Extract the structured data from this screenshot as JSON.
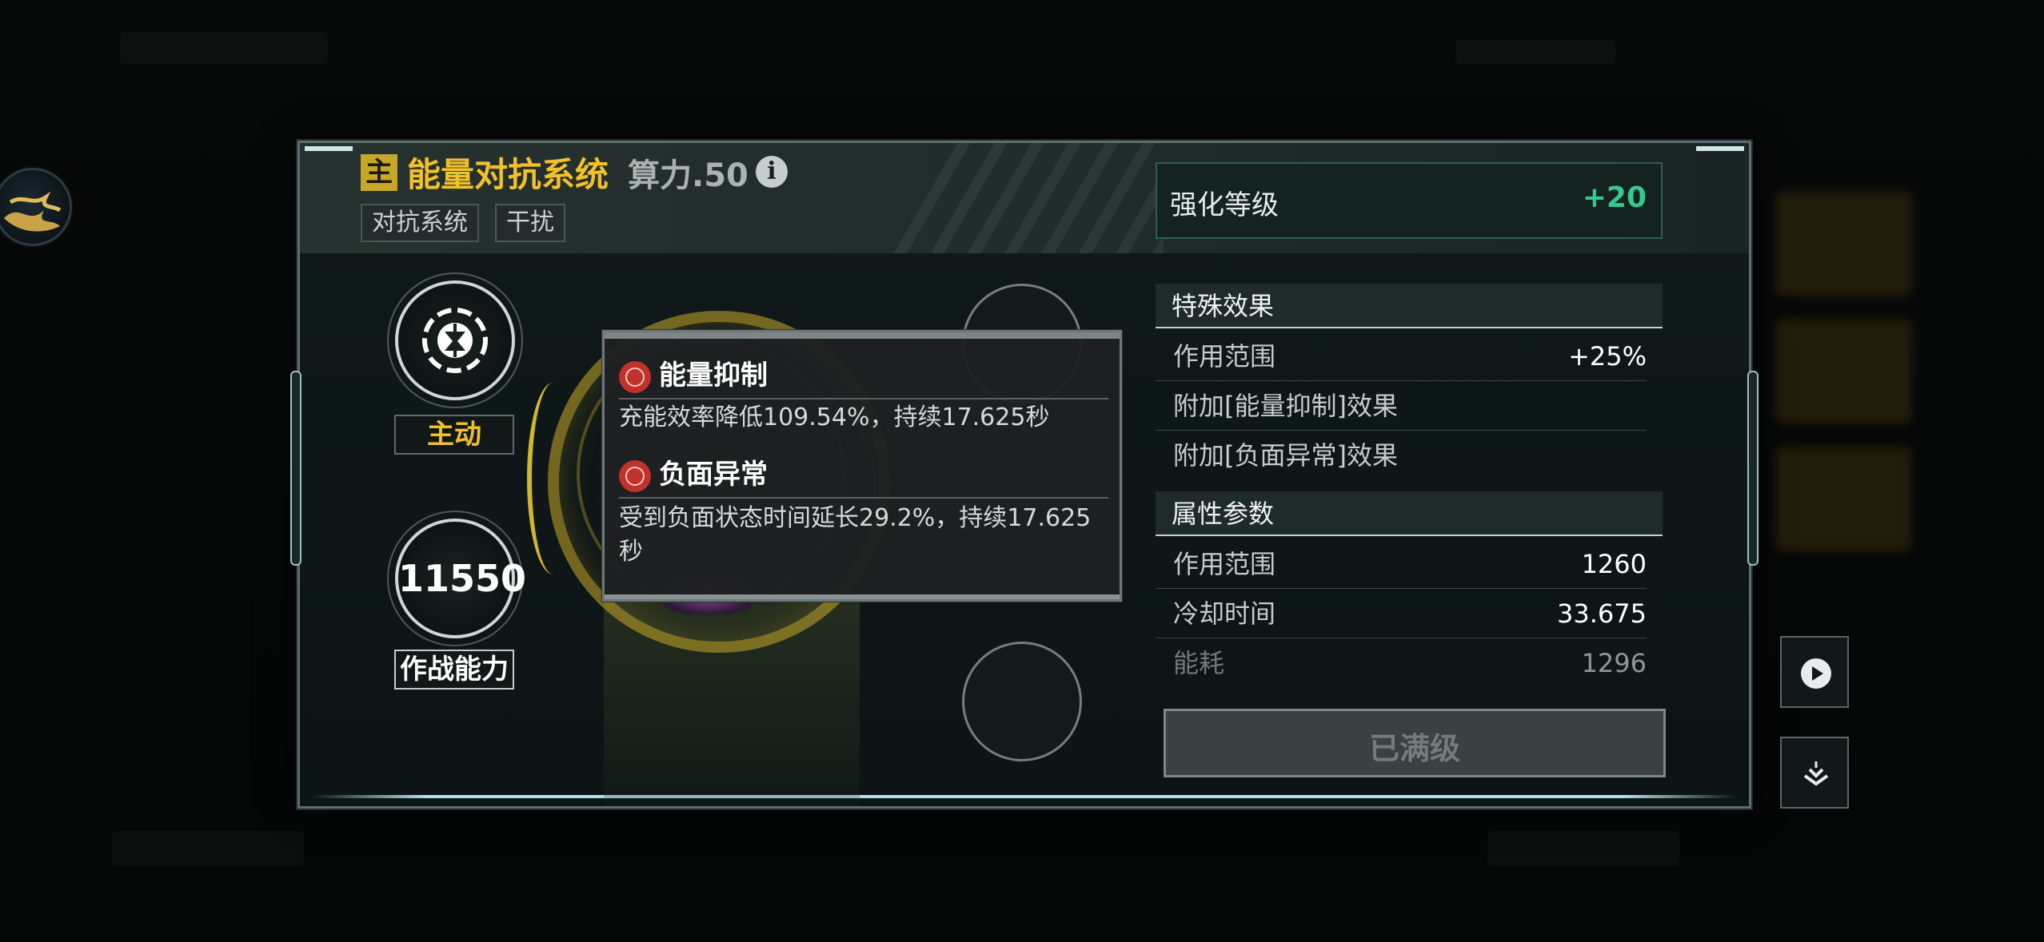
{
  "module": {
    "badge": "主",
    "name": "能量对抗系统",
    "power_label": "算力.50",
    "tags": [
      "对抗系统",
      "干扰"
    ]
  },
  "strengthen": {
    "label": "强化等级",
    "value": "+20"
  },
  "left": {
    "skill_mode": "主动",
    "combat_power": "11550",
    "combat_label": "作战能力"
  },
  "tooltip": {
    "effects": [
      {
        "name": "能量抑制",
        "desc": "充能效率降低109.54%，持续17.625秒"
      },
      {
        "name": "负面异常",
        "desc": "受到负面状态时间延长29.2%，持续17.625秒"
      }
    ]
  },
  "special": {
    "title": "特殊效果",
    "rows": [
      {
        "key": "作用范围",
        "value": "+25%"
      },
      {
        "key": "附加[能量抑制]效果",
        "value": ""
      },
      {
        "key": "附加[负面异常]效果",
        "value": ""
      }
    ]
  },
  "attributes": {
    "title": "属性参数",
    "rows": [
      {
        "key": "作用范围",
        "value": "1260"
      },
      {
        "key": "冷却时间",
        "value": "33.675"
      },
      {
        "key": "能耗",
        "value": "1296"
      }
    ]
  },
  "max_button": {
    "label": "已满级"
  },
  "colors": {
    "accent_gold": "#f2c02b",
    "accent_green": "#33c98f",
    "debuff_red": "#c0322b"
  },
  "icons": [
    "info-icon",
    "skill-emblem-icon",
    "energy-suppress-icon",
    "negative-status-icon",
    "play-icon",
    "collapse-icon",
    "avatar-icon"
  ]
}
